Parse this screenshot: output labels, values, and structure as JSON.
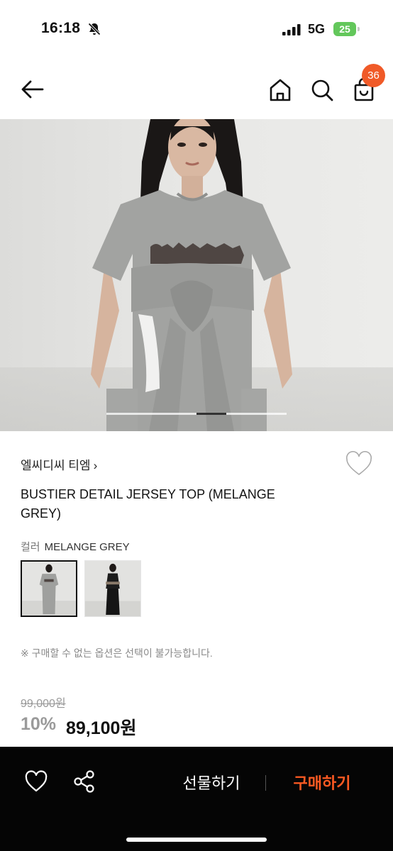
{
  "status_bar": {
    "time": "16:18",
    "network": "5G",
    "battery": "25",
    "icons": [
      "bell-off-icon",
      "signal-icon",
      "battery-icon"
    ]
  },
  "nav": {
    "cart_count": "36",
    "icons": [
      "back-arrow-icon",
      "home-icon",
      "search-icon",
      "shopping-bag-icon"
    ]
  },
  "product": {
    "brand": "엘씨디씨 티엠",
    "brand_chevron": "›",
    "name": "BUSTIER DETAIL JERSEY TOP (MELANGE GREY)",
    "color_label": "컬러",
    "color_value": "MELANGE GREY",
    "thumbnails": [
      "grey-jersey-look",
      "black-top-look"
    ],
    "image_index": 4,
    "image_count": 6
  },
  "notice": "※ 구매할 수 없는 옵션은 선택이 불가능합니다.",
  "price": {
    "original": "99,000원",
    "discount": "10%",
    "sale": "89,100원"
  },
  "bottom_bar": {
    "gift_label": "선물하기",
    "buy_label": "구매하기",
    "icons": [
      "heart-icon",
      "share-icon"
    ]
  },
  "colors": {
    "accent": "#f05a28",
    "buy_text": "#ff5a22",
    "battery": "#63c75b",
    "bottom_bar_bg": "#050505"
  }
}
